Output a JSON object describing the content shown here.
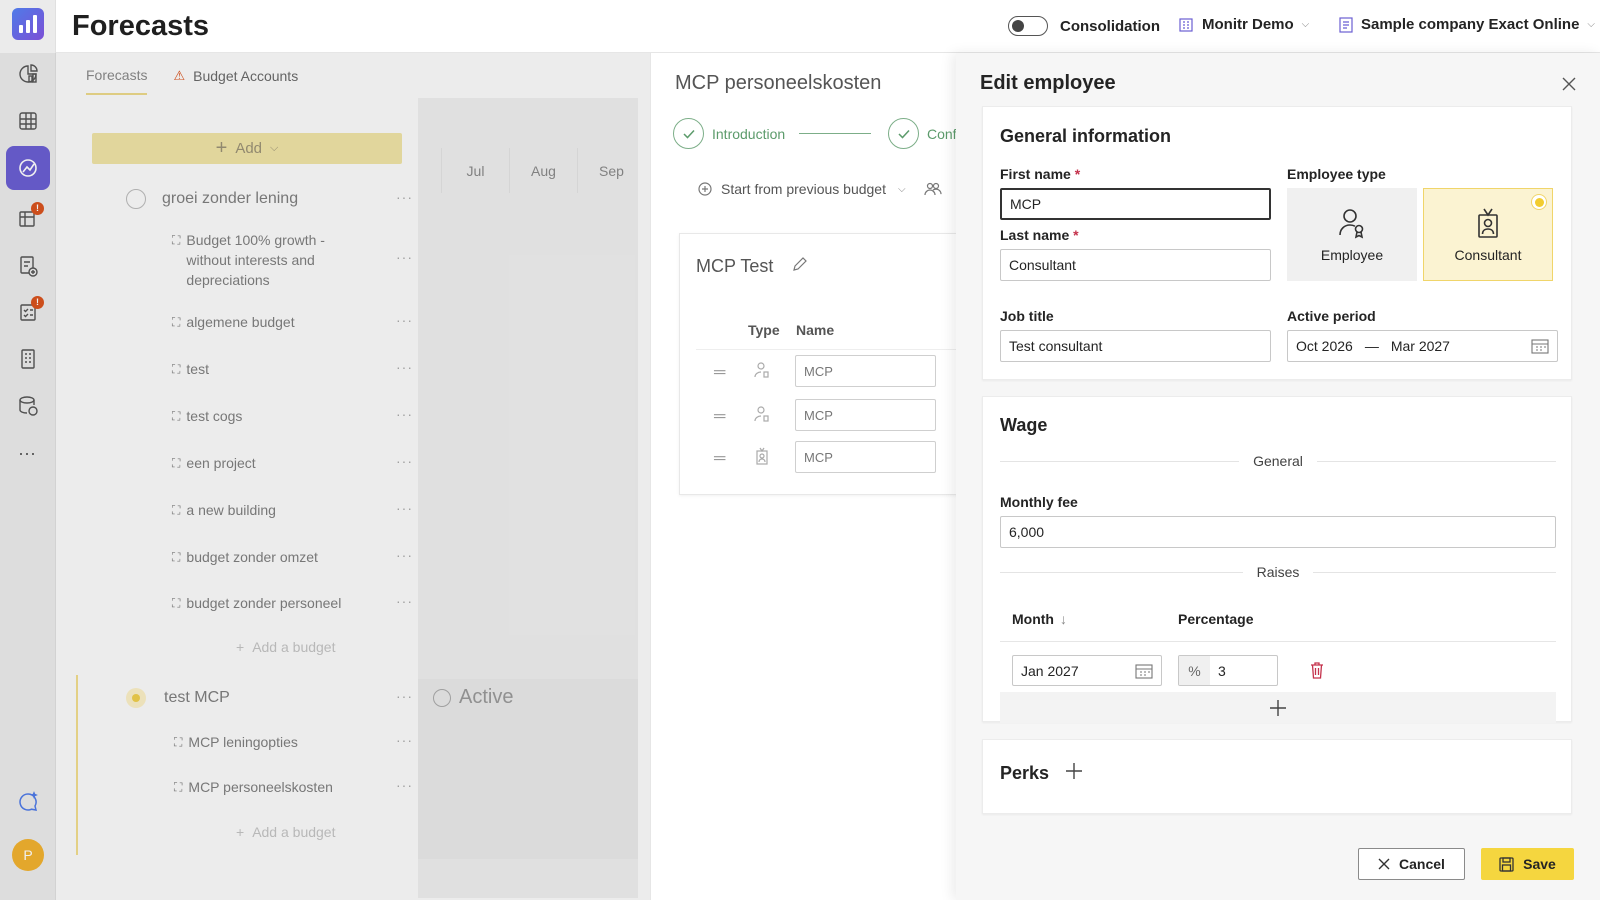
{
  "app": {
    "title": "Forecasts",
    "user_initial": "P"
  },
  "topbar": {
    "consolidation_label": "Consolidation",
    "workspace": "Monitr Demo",
    "company": "Sample company Exact Online"
  },
  "rail": {
    "badges": [
      "!",
      "!"
    ],
    "more": "···"
  },
  "tabs": [
    {
      "label": "Forecasts"
    },
    {
      "label": "Budget Accounts"
    }
  ],
  "list": {
    "add_label": "Add",
    "months": [
      "Jul",
      "Aug",
      "Sep"
    ],
    "group1": {
      "name": "groei zonder lening",
      "items": [
        "Budget 100% growth - without interests and depreciations",
        "algemene budget",
        "test",
        "test cogs",
        "een project",
        "a new building",
        "budget zonder omzet",
        "budget zonder personeel"
      ],
      "add_budget": "Add a budget"
    },
    "group2": {
      "name": "test MCP",
      "status": "Active",
      "items": [
        "MCP leningopties",
        "MCP personeelskosten"
      ],
      "add_budget": "Add a budget"
    },
    "dots": "···"
  },
  "mid": {
    "title": "MCP personeelskosten",
    "steps": [
      "Introduction",
      "Conf"
    ],
    "start_from": "Start from previous budget",
    "card_title": "MCP Test",
    "col_type": "Type",
    "col_name": "Name",
    "rows": [
      "MCP",
      "MCP",
      "MCP"
    ]
  },
  "edit": {
    "title": "Edit employee",
    "general": {
      "heading": "General information",
      "first_name_label": "First name",
      "first_name": "MCP",
      "last_name_label": "Last name",
      "last_name": "Consultant",
      "job_title_label": "Job title",
      "job_title": "Test consultant",
      "employee_type_label": "Employee type",
      "type_options": [
        "Employee",
        "Consultant"
      ],
      "selected_type": "Consultant",
      "active_period_label": "Active period",
      "period_start": "Oct 2026",
      "period_sep": "—",
      "period_end": "Mar 2027",
      "required_mark": "*"
    },
    "wage": {
      "heading": "Wage",
      "general_divider": "General",
      "monthly_fee_label": "Monthly fee",
      "monthly_fee": "6,000",
      "raises_divider": "Raises",
      "col_month": "Month",
      "col_percentage": "Percentage",
      "raise_month": "Jan 2027",
      "raise_unit": "%",
      "raise_pct": "3"
    },
    "perks": {
      "heading": "Perks"
    },
    "buttons": {
      "cancel": "Cancel",
      "save": "Save"
    }
  },
  "colors": {
    "accent_yellow": "#f5d63f",
    "rail_active": "#6b5fd3",
    "success_green": "#5c9b6b",
    "danger_red": "#c4314b",
    "badge_orange": "#d9531e"
  }
}
